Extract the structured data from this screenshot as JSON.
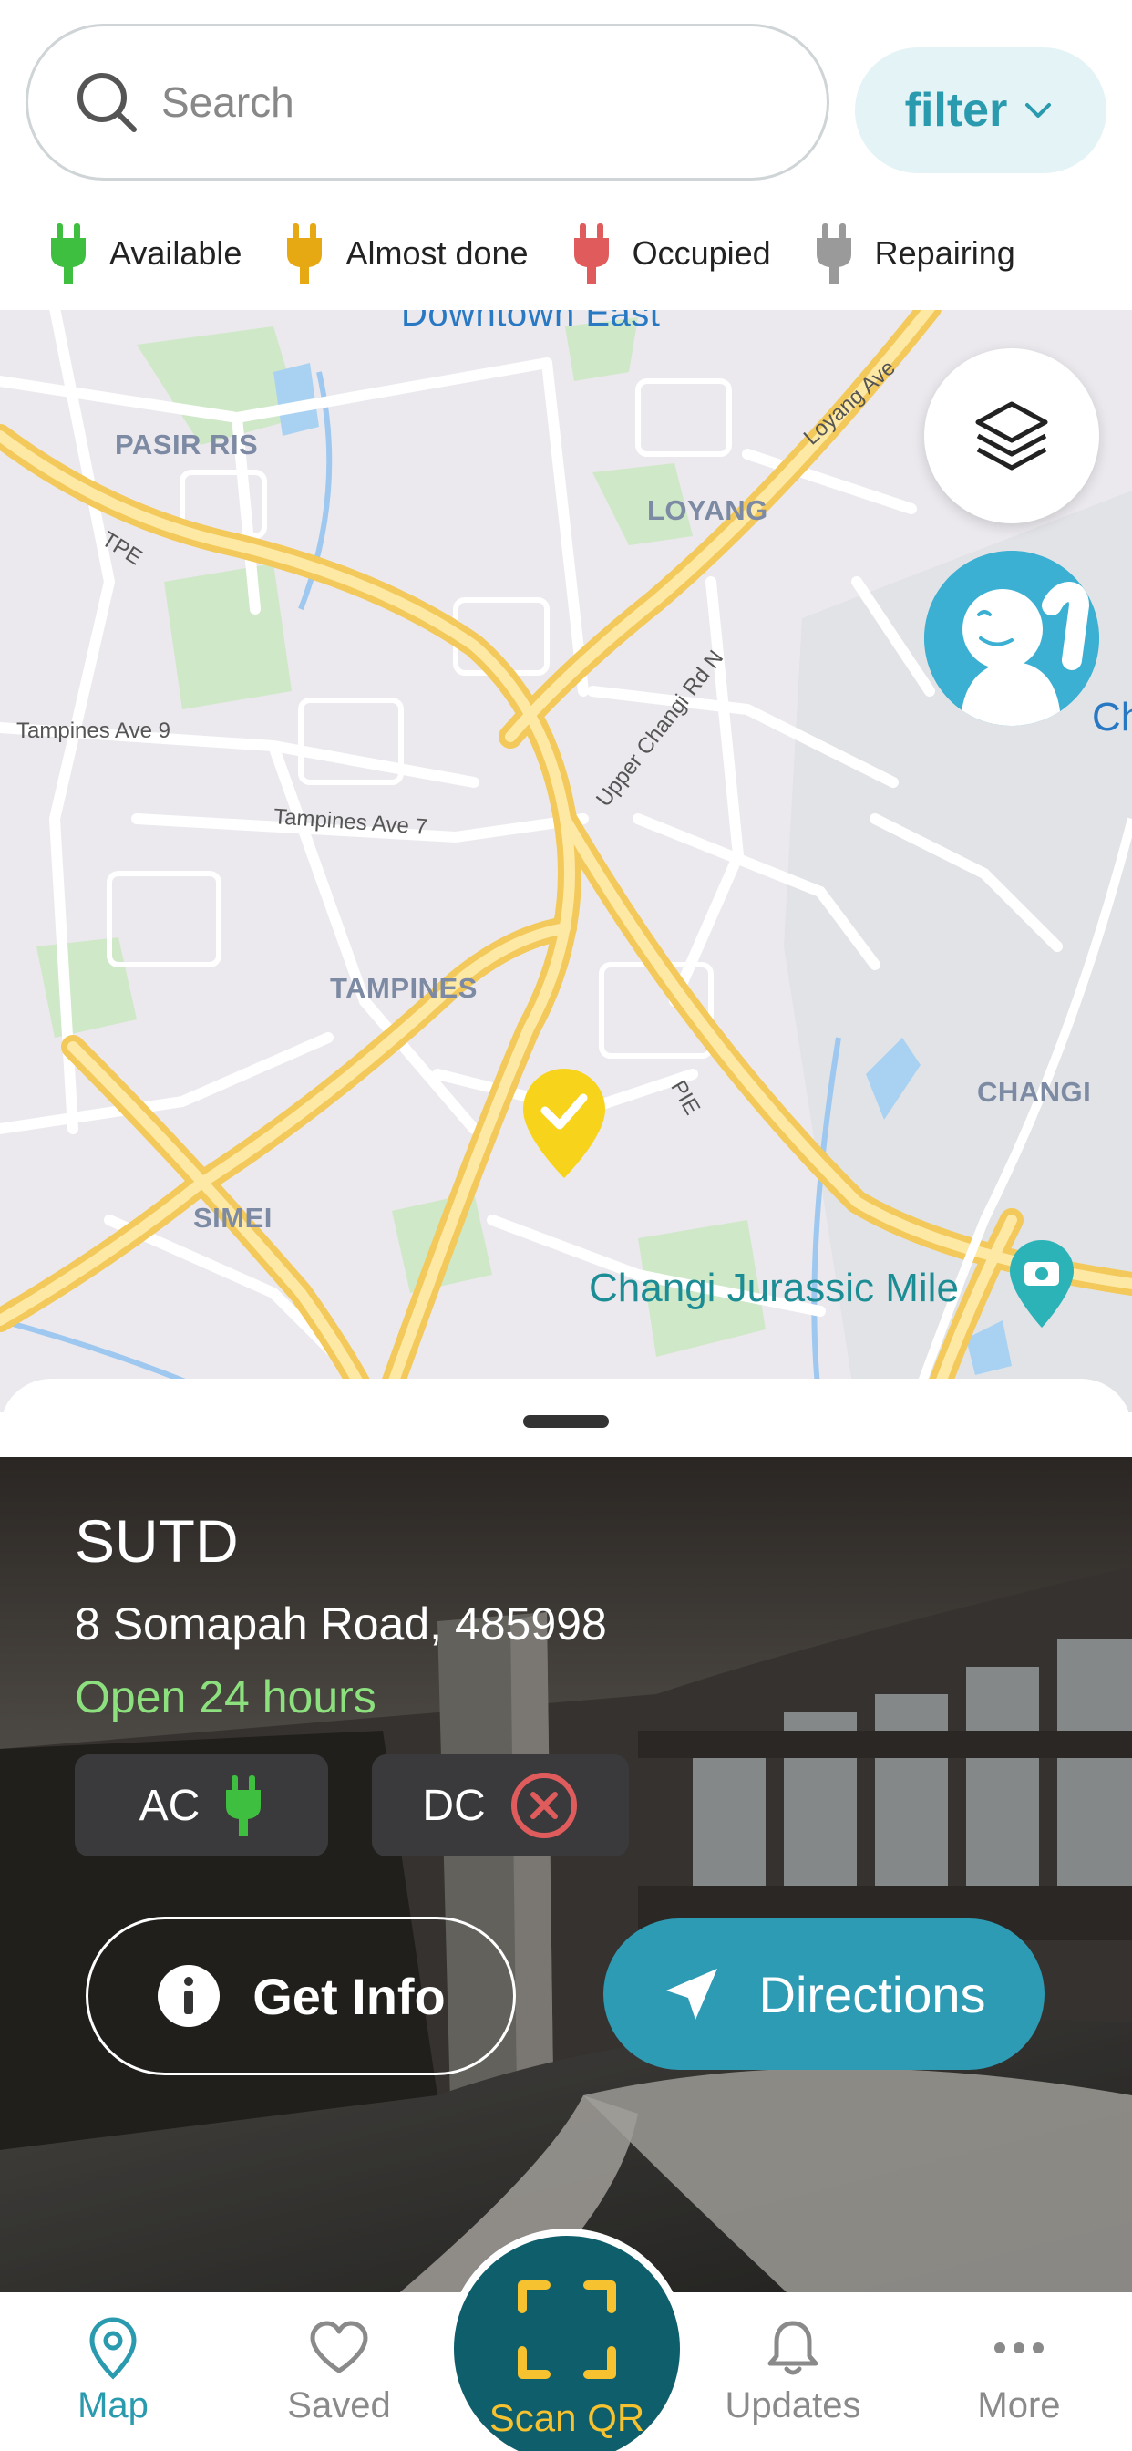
{
  "search": {
    "placeholder": "Search",
    "value": ""
  },
  "filter": {
    "label": "filter"
  },
  "legend": [
    {
      "label": "Available",
      "color": "#3fbf3f"
    },
    {
      "label": "Almost done",
      "color": "#e6a813"
    },
    {
      "label": "Occupied",
      "color": "#e05c5c"
    },
    {
      "label": "Repairing",
      "color": "#9a9a9a"
    }
  ],
  "map": {
    "labels": {
      "downtown_east": "Downtown East",
      "pasir_ris": "PASIR RIS",
      "loyang": "LOYANG",
      "tampines": "TAMPINES",
      "simei": "SIMEI",
      "changi": "CHANGI",
      "tpe": "TPE",
      "pie": "PIE",
      "loyang_ave": "Loyang Ave",
      "tampines_ave_9": "Tampines Ave 9",
      "tampines_ave_7": "Tampines Ave 7",
      "upper_changi_rd_n": "Upper Changi Rd N",
      "changi_jurassic_mile": "Changi Jurassic Mile",
      "edge_label": "Ch"
    },
    "marker_color": "#f7d31c"
  },
  "station": {
    "name": "SUTD",
    "address": "8 Somapah Road, 485998",
    "hours": "Open 24 hours",
    "ac_label": "AC",
    "ac_status": "available",
    "dc_label": "DC",
    "dc_status": "unavailable"
  },
  "actions": {
    "get_info": "Get Info",
    "directions": "Directions"
  },
  "nav": {
    "map": "Map",
    "saved": "Saved",
    "scan": "Scan QR",
    "updates": "Updates",
    "more": "More",
    "active": "Map"
  },
  "colors": {
    "accent": "#2a9aae",
    "scan_bg": "#0f5e6b",
    "scan_accent": "#f6c230"
  }
}
